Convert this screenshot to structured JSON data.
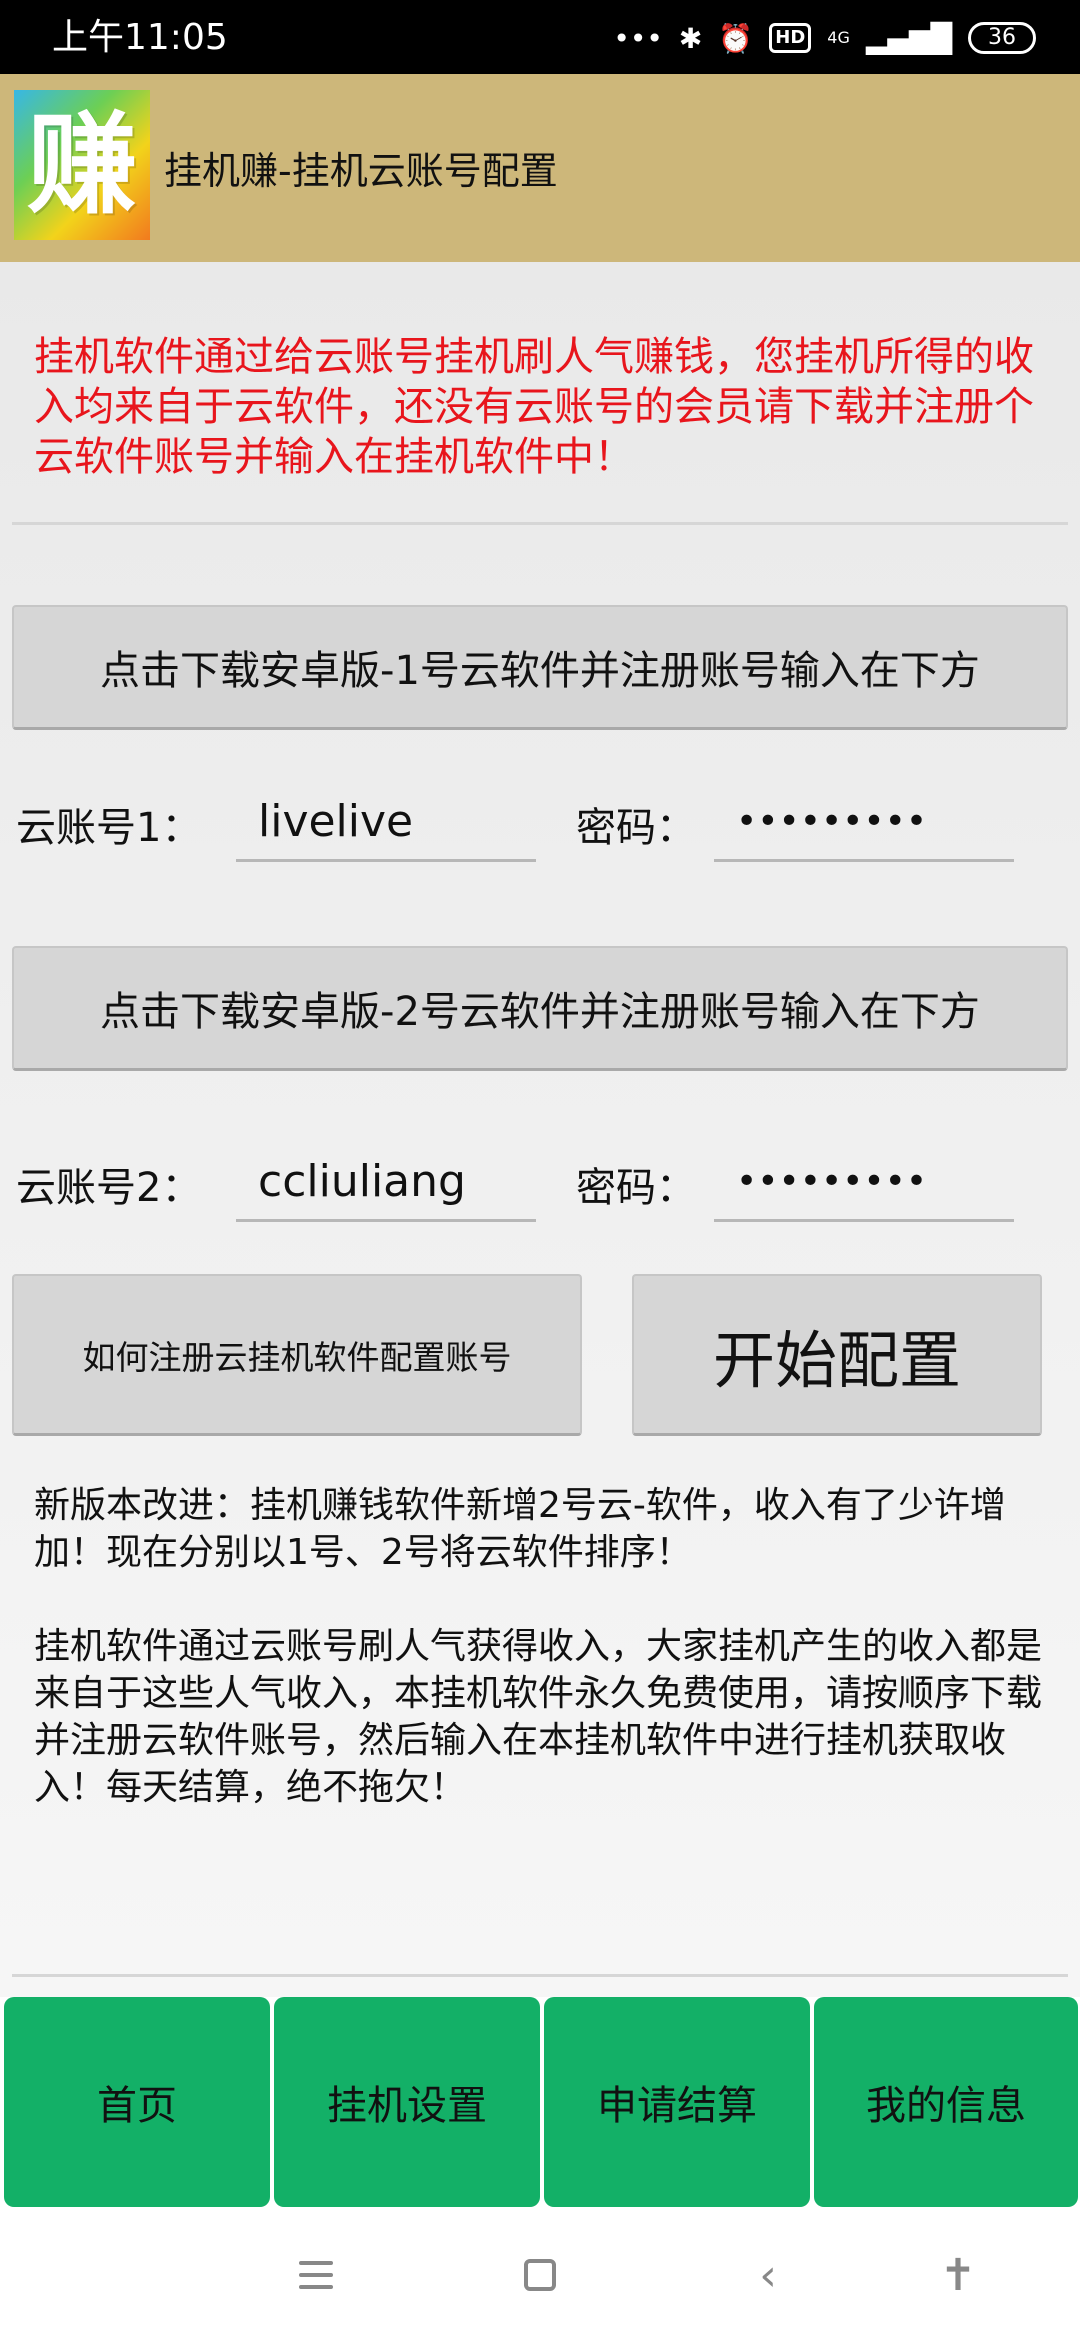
{
  "status_bar": {
    "time": "上午11:05",
    "dots": "•••",
    "bluetooth_icon": "✱",
    "alarm_icon": "⏰",
    "hd": "HD",
    "network": "4G",
    "signal_icon": "▂▄▆█",
    "battery": "36"
  },
  "header": {
    "logo_char": "赚",
    "title": "挂机赚-挂机云账号配置"
  },
  "notice": {
    "text": "挂机软件通过给云账号挂机刷人气赚钱，您挂机所得的收入均来自于云软件，还没有云账号的会员请下载并注册个云软件账号并输入在挂机软件中！",
    "color": "#e8151c"
  },
  "download1": {
    "label": "点击下载安卓版-1号云软件并注册账号输入在下方"
  },
  "account1": {
    "label": "云账号1：",
    "value": "livelive",
    "password_label": "密码：",
    "password_value": "•••••••••"
  },
  "download2": {
    "label": "点击下载安卓版-2号云软件并注册账号输入在下方"
  },
  "account2": {
    "label": "云账号2：",
    "value": "ccliuliang",
    "password_label": "密码：",
    "password_value": "•••••••••"
  },
  "actions": {
    "howto_label": "如何注册云挂机软件配置账号",
    "start_label": "开始配置"
  },
  "info": {
    "paragraph1": "新版本改进：挂机赚钱软件新增2号云-软件，收入有了少许增加！现在分别以1号、2号将云软件排序！",
    "paragraph2": "挂机软件通过云账号刷人气获得收入，大家挂机产生的收入都是来自于这些人气收入，本挂机软件永久免费使用，请按顺序下载并注册云软件账号，然后输入在本挂机软件中进行挂机获取收入！每天结算，绝不拖欠！"
  },
  "tabs": [
    {
      "label": "首页"
    },
    {
      "label": "挂机设置"
    },
    {
      "label": "申请结算"
    },
    {
      "label": "我的信息"
    }
  ],
  "colors": {
    "header_bg": "#cdb77a",
    "tab_bg": "#13b067",
    "button_bg": "#d6d6d6"
  },
  "system_nav": {
    "back_icon": "‹",
    "accessibility_icon": "✝"
  }
}
